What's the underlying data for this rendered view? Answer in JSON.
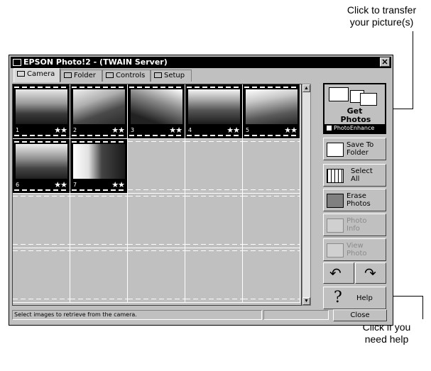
{
  "callouts": {
    "transfer": [
      "Click to transfer",
      "your picture(s)"
    ],
    "help": [
      "Click if you",
      "need help"
    ]
  },
  "window": {
    "title": "EPSON Photo!2 - (TWAIN Server)",
    "close_glyph": "✕"
  },
  "tabs": [
    {
      "label": "Camera",
      "icon": "camera-icon",
      "active": true
    },
    {
      "label": "Folder",
      "icon": "folder-icon",
      "active": false
    },
    {
      "label": "Controls",
      "icon": "sliders-icon",
      "active": false
    },
    {
      "label": "Setup",
      "icon": "setup-icon",
      "active": false
    }
  ],
  "thumbnails": [
    {
      "number": "1",
      "stars": "★★"
    },
    {
      "number": "2",
      "stars": "★★"
    },
    {
      "number": "3",
      "stars": "★★"
    },
    {
      "number": "4",
      "stars": "★★"
    },
    {
      "number": "5",
      "stars": "★★"
    },
    {
      "number": "6",
      "stars": "★★"
    },
    {
      "number": "7",
      "stars": "★★"
    }
  ],
  "sidebar": {
    "get_photos": "Get Photos",
    "photo_enhance": "PhotoEnhance",
    "save_to_folder": "Save To Folder",
    "select_all": "Select All",
    "erase_photos": "Erase Photos",
    "photo_info": "Photo Info",
    "view_photo": "View Photo",
    "help": "Help"
  },
  "status": {
    "message": "Select images to retrieve from the camera.",
    "close_label": "Close"
  },
  "colors": {
    "titlebar": "#000000",
    "window_face": "#c0c0c0"
  }
}
